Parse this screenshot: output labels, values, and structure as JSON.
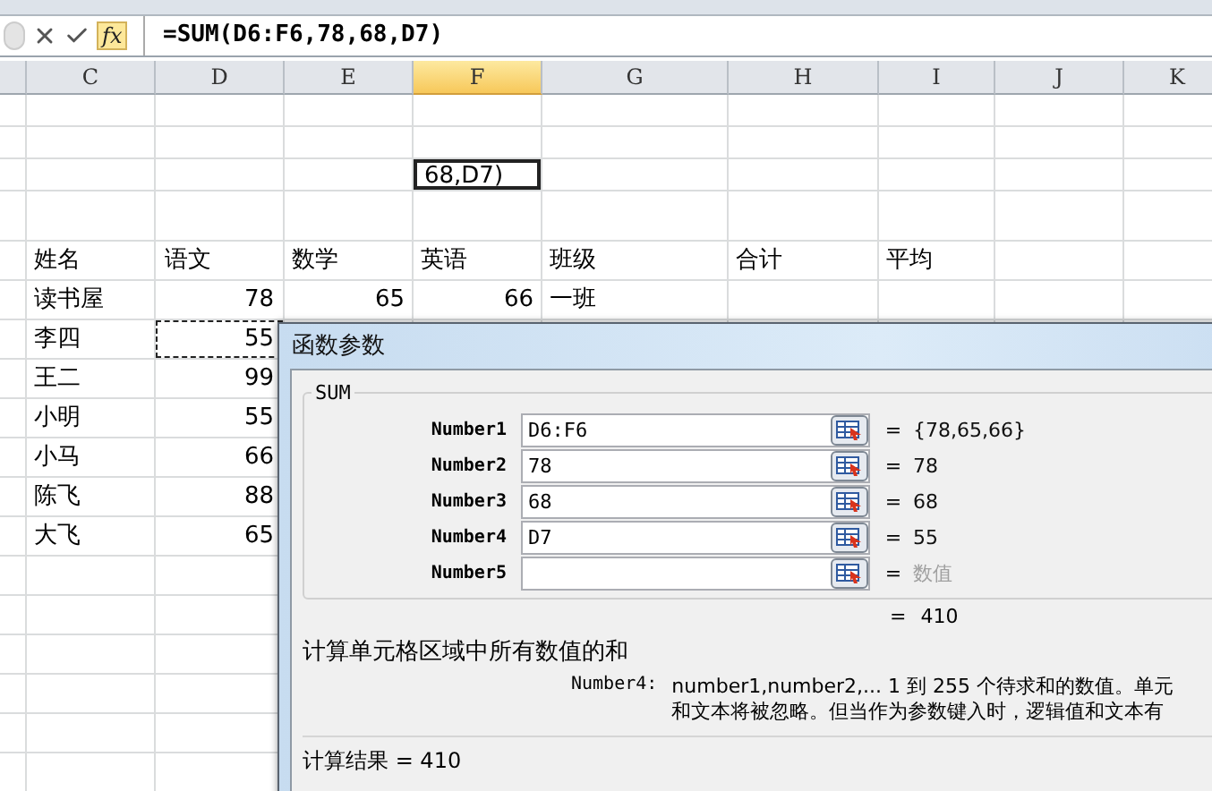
{
  "formula_bar": {
    "fx": "fx",
    "formula": "=SUM(D6:F6,78,68,D7)"
  },
  "columns": [
    {
      "label": "C",
      "selected": false
    },
    {
      "label": "D",
      "selected": false
    },
    {
      "label": "E",
      "selected": false
    },
    {
      "label": "F",
      "selected": true
    },
    {
      "label": "G",
      "selected": false
    },
    {
      "label": "H",
      "selected": false
    },
    {
      "label": "I",
      "selected": false
    },
    {
      "label": "J",
      "selected": false
    },
    {
      "label": "K",
      "selected": false
    }
  ],
  "editing_cell": {
    "value": "68,D7)"
  },
  "rows": [
    {
      "cells": [
        "姓名",
        "语文",
        "数学",
        "英语",
        "班级",
        "合计",
        "平均"
      ],
      "marquee": false
    },
    {
      "cells": [
        "读书屋",
        "78",
        "65",
        "66",
        "一班"
      ],
      "marquee": false
    },
    {
      "cells": [
        "李四",
        "55"
      ],
      "marquee": true
    },
    {
      "cells": [
        "王二",
        "99"
      ],
      "marquee": false
    },
    {
      "cells": [
        "小明",
        "55"
      ],
      "marquee": false
    },
    {
      "cells": [
        "小马",
        "66"
      ],
      "marquee": false
    },
    {
      "cells": [
        "陈飞",
        "88"
      ],
      "marquee": false
    },
    {
      "cells": [
        "大飞",
        "65"
      ],
      "marquee": false
    }
  ],
  "dialog": {
    "title": "函数参数",
    "group": "SUM",
    "args": [
      {
        "label": "Number1",
        "value": "D6:F6",
        "equals": "=",
        "result": "{78,65,66}",
        "dimmed": false
      },
      {
        "label": "Number2",
        "value": "78",
        "equals": "=",
        "result": "78",
        "dimmed": false
      },
      {
        "label": "Number3",
        "value": "68",
        "equals": "=",
        "result": "68",
        "dimmed": false
      },
      {
        "label": "Number4",
        "value": "D7",
        "equals": "=",
        "result": "55",
        "dimmed": false
      },
      {
        "label": "Number5",
        "equals": "=",
        "result": "数值",
        "dimmed": true
      }
    ],
    "total": {
      "equals": "=",
      "value": "410"
    },
    "description": "计算单元格区域中所有数值的和",
    "help": {
      "label": "Number4:",
      "lines": [
        "number1,number2,...   1 到 255 个待求和的数值。单元",
        "和文本将被忽略。但当作为参数键入时，逻辑值和文本有"
      ]
    },
    "result": "计算结果 = 410"
  }
}
